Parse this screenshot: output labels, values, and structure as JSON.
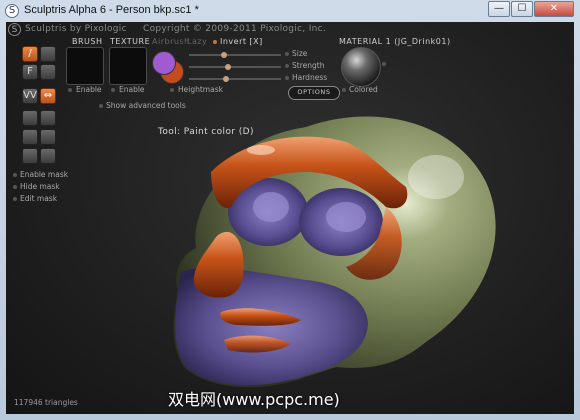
{
  "window": {
    "title": "Sculptris Alpha 6 - Person bkp.sc1 *",
    "icon": "S",
    "min_label": "—",
    "max_label": "☐",
    "close_label": "✕"
  },
  "header": {
    "logo": "S",
    "app": "Sculptris by Pixologic",
    "copyright": "Copyright © 2009-2011 Pixologic, Inc."
  },
  "tools": {
    "paint": "/",
    "flatten": "F",
    "mirror": "VV",
    "symmetry": "⇔"
  },
  "brush": {
    "label": "BRUSH",
    "enable": "Enable"
  },
  "texture": {
    "label": "TEXTURE",
    "enable": "Enable"
  },
  "airbrush": "Airbrush",
  "lazy": "Lazy",
  "invert": "Invert [X]",
  "sliders": {
    "size": "Size",
    "strength": "Strength",
    "hardness": "Hardness"
  },
  "heightmask": "Heightmask",
  "options": "OPTIONS",
  "material": {
    "label": "MATERIAL 1 (JG_Drink01)",
    "colored": "Colored"
  },
  "advanced": "Show advanced tools",
  "masks": {
    "enable": "Enable mask",
    "hide": "Hide mask",
    "edit": "Edit mask"
  },
  "tool_name": "Tool: Paint color (D)",
  "triangles": "117946 triangles",
  "watermark": "双电网(www.pcpc.me)",
  "colors": {
    "accent": "#d8743a",
    "swatch_primary": "#a05bd0",
    "swatch_secondary": "#c44a20",
    "head_base": "#7e8a5c",
    "paint_orange": "#c8541a",
    "paint_purple": "#5a4a8a"
  }
}
